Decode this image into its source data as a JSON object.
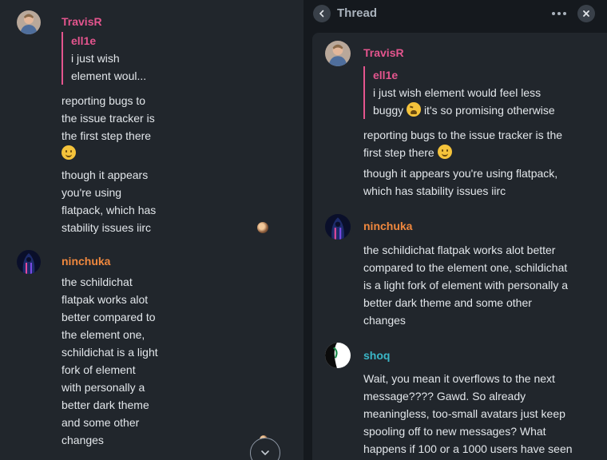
{
  "timeline": {
    "messages": [
      {
        "sender": "TravisR",
        "quote_sender": "ell1e",
        "quote_lines": [
          "i just wish",
          "element woul..."
        ],
        "lines": [
          "reporting bugs to",
          "the issue tracker is",
          "the first step there"
        ],
        "lines2": [
          "though it appears",
          "you're using",
          "flatpack, which has",
          "stability issues iirc"
        ]
      },
      {
        "sender": "ninchuka",
        "lines": [
          "the schildichat",
          "flatpak works alot",
          "better compared to",
          "the element one,",
          "schildichat is a light",
          "fork of element",
          "with personally a",
          "better dark theme",
          "and some other",
          "changes"
        ]
      }
    ]
  },
  "thread": {
    "title": "Thread",
    "messages": [
      {
        "sender": "TravisR",
        "quote_sender": "ell1e",
        "quote_line1": "i just wish element would feel less",
        "quote_line2a": "buggy",
        "quote_line2b": "it's so promising otherwise",
        "line1": "reporting bugs to the issue tracker is the",
        "line2": "first step there",
        "line3": "though it appears you're using flatpack,",
        "line4": "which has stability issues iirc"
      },
      {
        "sender": "ninchuka",
        "lines": [
          "the schildichat flatpak works alot better",
          "compared to the element one, schildichat",
          "is a light fork of element with personally a",
          "better dark theme and some other",
          "changes"
        ]
      },
      {
        "sender": "shoq",
        "lines": [
          "Wait, you mean it overflows to the next",
          "message????  Gawd. So already",
          "meaningless, too-small avatars just keep",
          "spooling off to new messages? What",
          "happens if 100 or a 1000 users have seen"
        ]
      }
    ]
  },
  "colors": {
    "background": "#21262c",
    "panel_background": "#15191e",
    "sender_travisr": "#e4558e",
    "sender_ninchuka": "#f0883e",
    "sender_shoq": "#3ab6c7"
  }
}
